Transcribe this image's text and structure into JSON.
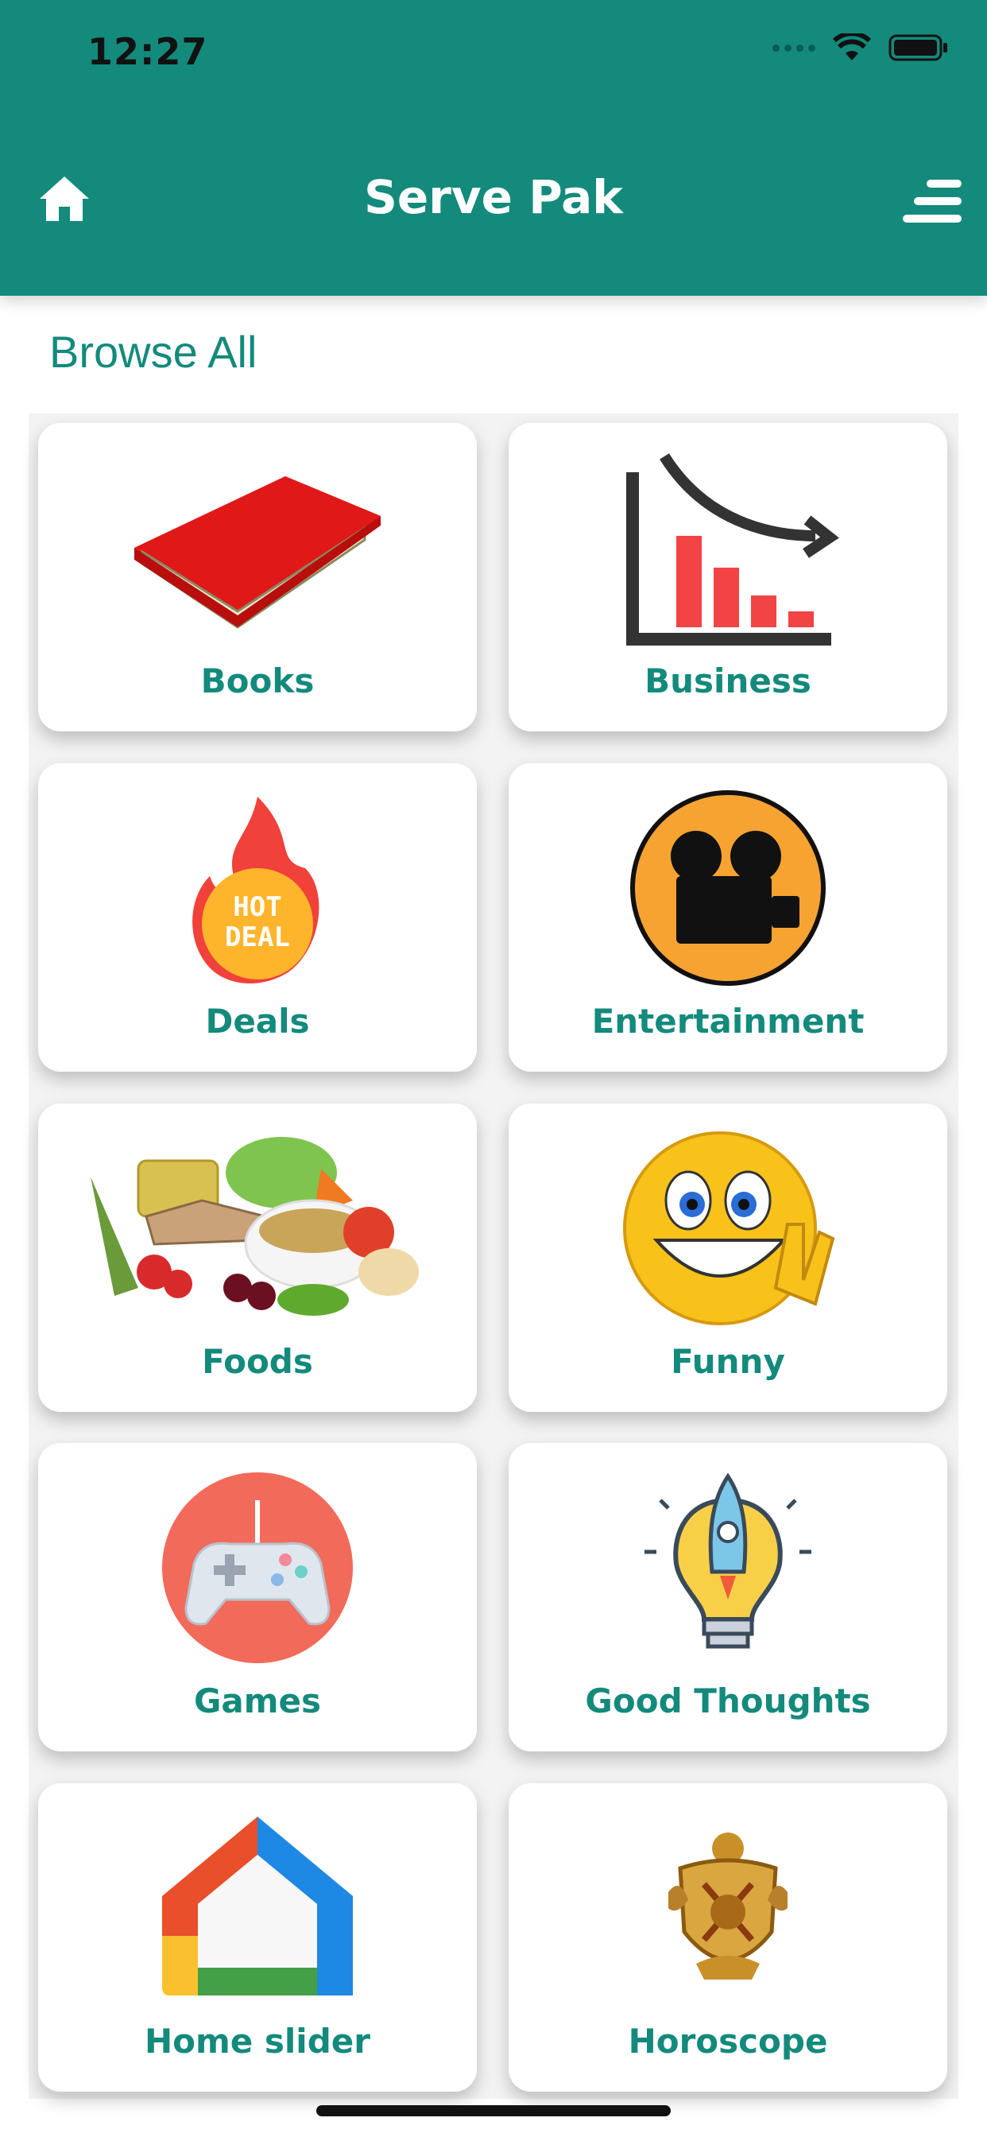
{
  "status_bar": {
    "time": "12:27"
  },
  "header": {
    "title": "Serve Pak"
  },
  "section": {
    "title": "Browse All"
  },
  "categories": [
    {
      "label": "Books",
      "icon": "book-icon"
    },
    {
      "label": "Business",
      "icon": "chart-down-icon"
    },
    {
      "label": "Deals",
      "icon": "hot-deal-icon",
      "badge_text": "HOT DEAL"
    },
    {
      "label": "Entertainment",
      "icon": "movie-camera-icon"
    },
    {
      "label": "Foods",
      "icon": "food-icon"
    },
    {
      "label": "Funny",
      "icon": "smiley-icon"
    },
    {
      "label": "Games",
      "icon": "gamepad-icon"
    },
    {
      "label": "Good Thoughts",
      "icon": "rocket-bulb-icon"
    },
    {
      "label": "Home slider",
      "icon": "home-slider-icon"
    },
    {
      "label": "Horoscope",
      "icon": "crest-icon"
    }
  ],
  "colors": {
    "primary": "#138a7c",
    "header_text": "#ffffff",
    "card_bg": "#ffffff"
  }
}
